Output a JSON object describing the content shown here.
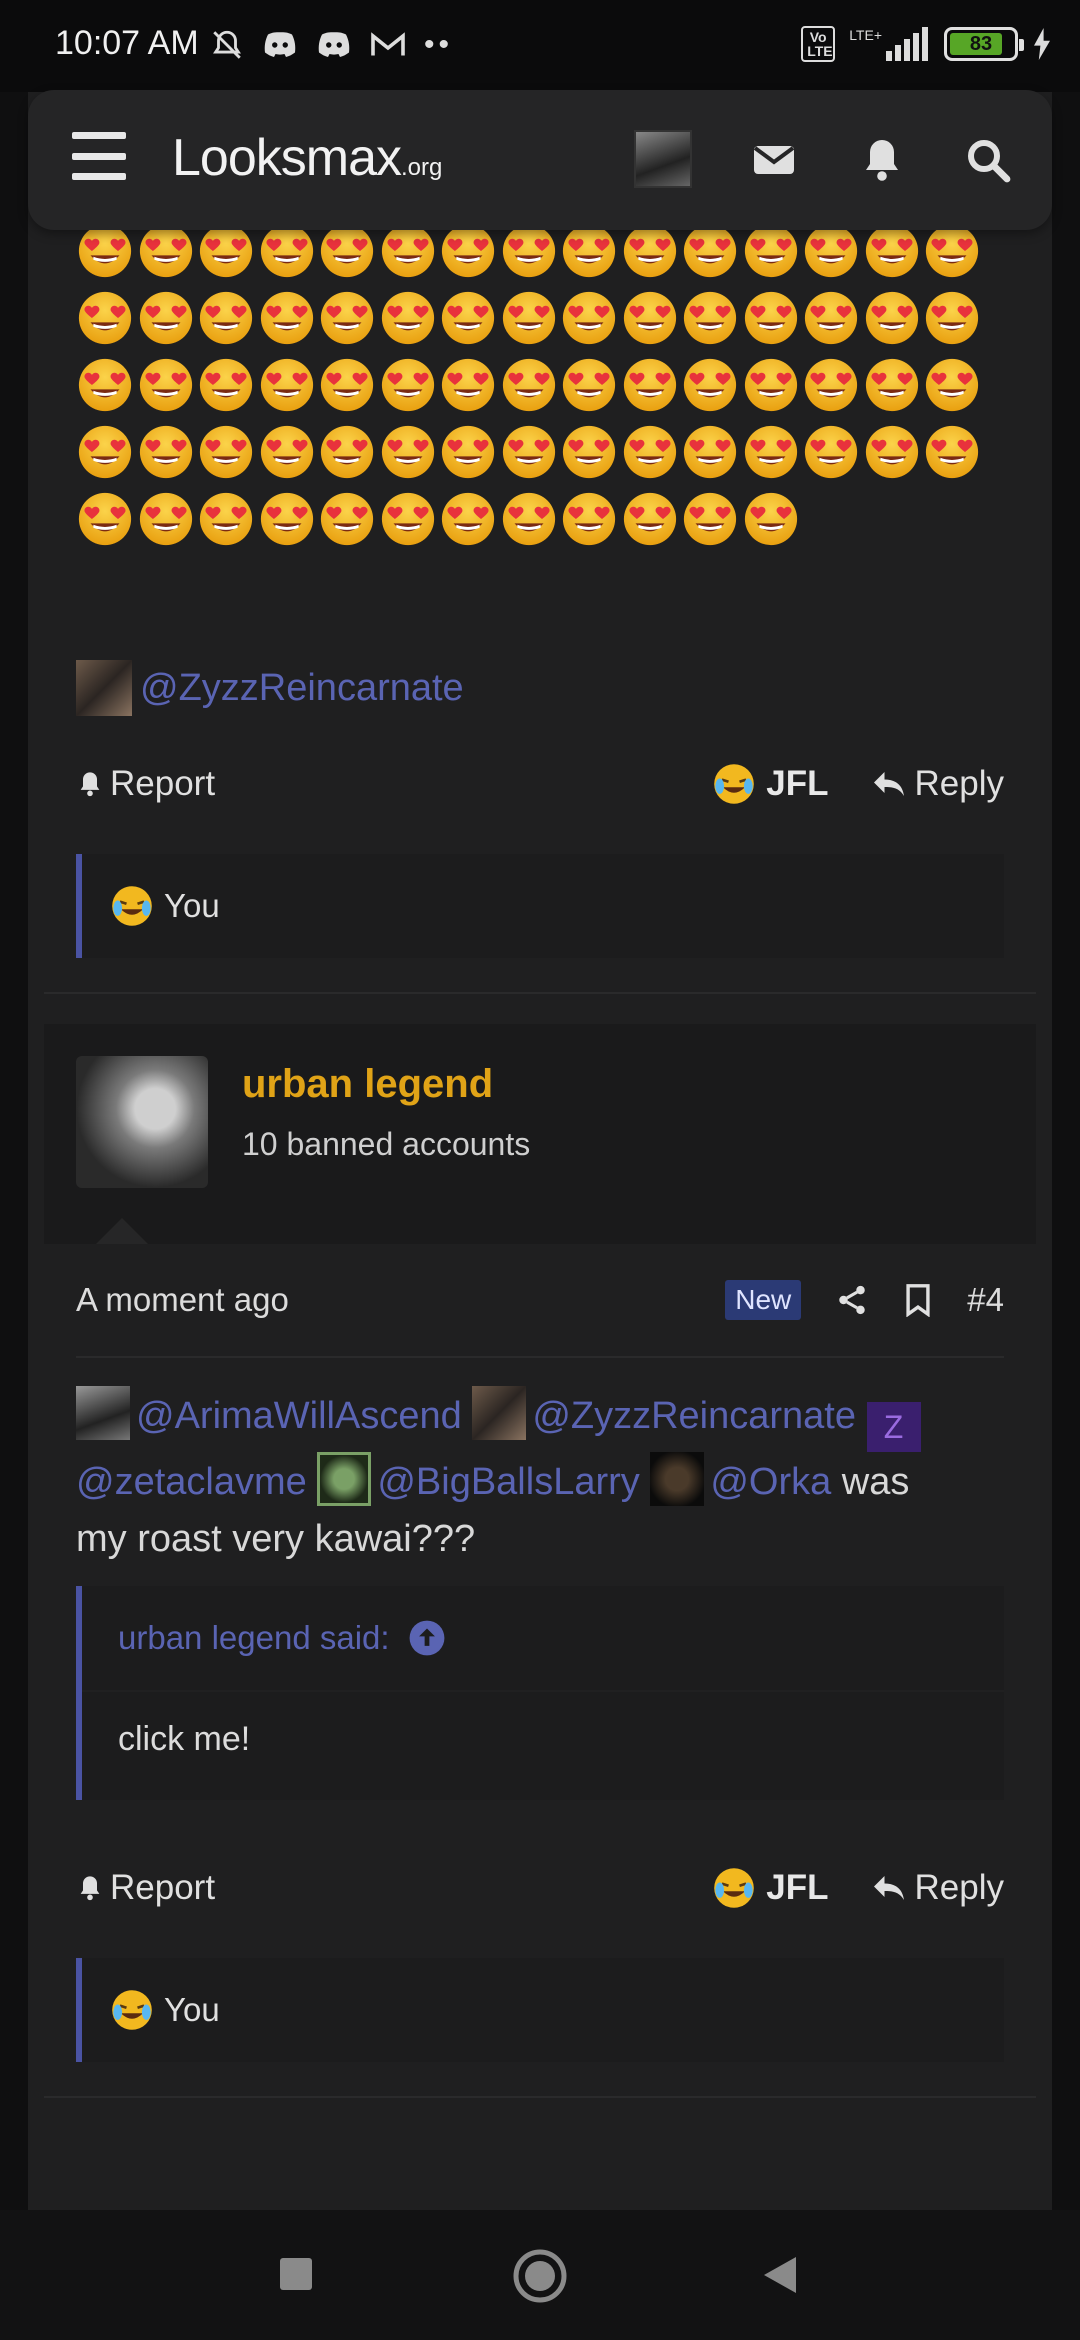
{
  "status_bar": {
    "time": "10:07 AM",
    "volte": "Vo LTE",
    "lte": "LTE+",
    "battery": "83"
  },
  "header": {
    "logo_main": "Looksmax",
    "logo_suffix": ".org",
    "icons": [
      "menu-icon",
      "user-avatar",
      "mail-icon",
      "bell-icon",
      "search-icon"
    ]
  },
  "post1": {
    "emoji": "heart-eyes",
    "emoji_count": 72,
    "mention": "@ZyzzReincarnate",
    "report_label": "Report",
    "reaction_label": "JFL",
    "reply_label": "Reply",
    "reaction_user": "You"
  },
  "post2": {
    "username": "urban legend",
    "user_title": "10 banned accounts",
    "time": "A moment ago",
    "badge": "New",
    "post_number": "#4",
    "mentions": [
      "@ArimaWillAscend",
      "@ZyzzReincarnate",
      "@zetaclavme",
      "@BigBallsLarry",
      "@Orka"
    ],
    "z_avatar": "Z",
    "body_text_a": " was",
    "body_text_b": "my roast very kawai???",
    "quote_author": "urban legend said:",
    "quote_body": "click me!",
    "report_label": "Report",
    "reaction_label": "JFL",
    "reply_label": "Reply",
    "reaction_user": "You"
  },
  "colors": {
    "accent_link": "#5a64b3",
    "username": "#e0a317",
    "background": "#1f1f20"
  }
}
